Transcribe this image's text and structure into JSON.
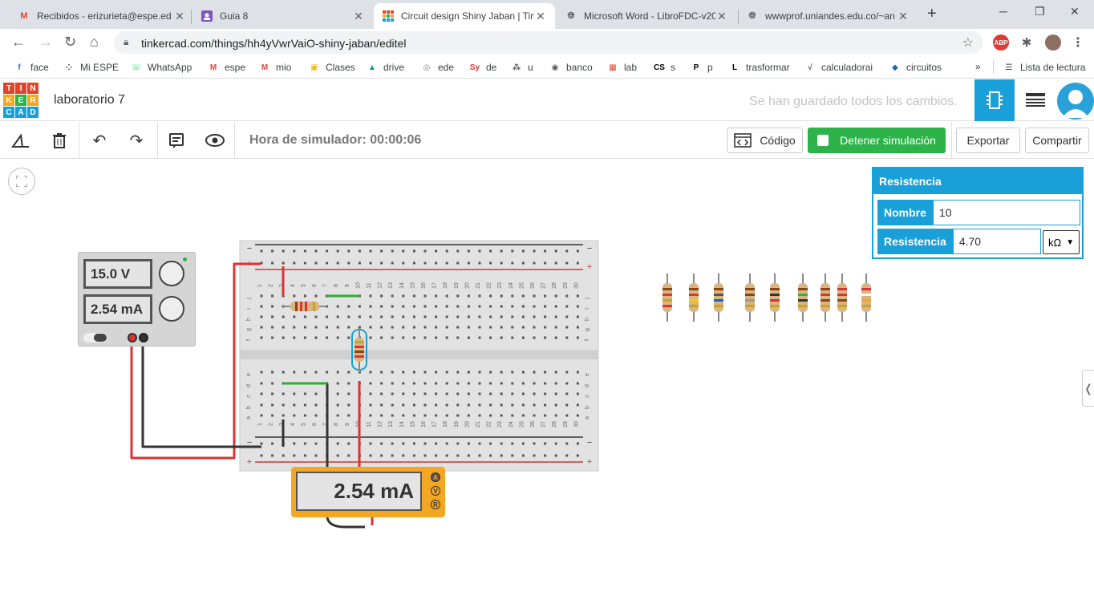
{
  "browser": {
    "tabs": [
      {
        "title": "Recibidos - erizurieta@espe.ed",
        "icon": "gmail-icon",
        "active": false
      },
      {
        "title": "Guia 8",
        "icon": "classroom-icon",
        "active": false
      },
      {
        "title": "Circuit design Shiny Jaban | Tin",
        "icon": "tinkercad-icon",
        "active": true
      },
      {
        "title": "Microsoft Word - LibroFDC-v20",
        "icon": "globe-icon",
        "active": false
      },
      {
        "title": "wwwprof.uniandes.edu.co/~an",
        "icon": "globe-icon",
        "active": false
      }
    ],
    "url": "tinkercad.com/things/hh4yVwrVaiO-shiny-jaban/editel",
    "bookmarks": [
      {
        "label": "face",
        "icon": "facebook-icon",
        "color": "#1877f2"
      },
      {
        "label": "Mi ESPE",
        "icon": "grid-icon",
        "color": "#333333"
      },
      {
        "label": "WhatsApp",
        "icon": "whatsapp-icon",
        "color": "#25d366"
      },
      {
        "label": "espe",
        "icon": "gmail-icon",
        "color": "#ea4335"
      },
      {
        "label": "mio",
        "icon": "gmail-icon",
        "color": "#ea4335"
      },
      {
        "label": "Clases",
        "icon": "classroom-icon",
        "color": "#f4b400"
      },
      {
        "label": "drive",
        "icon": "drive-icon",
        "color": "#0f9d58"
      },
      {
        "label": "ede",
        "icon": "ede-icon",
        "color": "#888888"
      },
      {
        "label": "de",
        "icon": "sy-icon",
        "color": "#e53935"
      },
      {
        "label": "u",
        "icon": "u-icon",
        "color": "#555555"
      },
      {
        "label": "banco",
        "icon": "globe-icon",
        "color": "#555555"
      },
      {
        "label": "lab",
        "icon": "tinkercad-icon",
        "color": "#e0452b"
      },
      {
        "label": "s",
        "icon": "cs-icon",
        "color": "#000000"
      },
      {
        "label": "p",
        "icon": "p-icon",
        "color": "#000000"
      },
      {
        "label": "trasformar",
        "icon": "l-icon",
        "color": "#000000"
      },
      {
        "label": "calculadorai",
        "icon": "calc-icon",
        "color": "#555555"
      },
      {
        "label": "circuitos",
        "icon": "circuit-icon",
        "color": "#1565c0"
      }
    ],
    "reading_list": "Lista de lectura"
  },
  "header": {
    "project_name": "laboratorio 7",
    "save_status": "Se han guardado todos los cambios."
  },
  "toolbar": {
    "sim_time": "Hora de simulador: 00:00:06",
    "code_label": "Código",
    "stop_label": "Detener simulación",
    "export_label": "Exportar",
    "share_label": "Compartir"
  },
  "inspector": {
    "title": "Resistencia",
    "name_label": "Nombre",
    "name_value": "10",
    "resistance_label": "Resistencia",
    "resistance_value": "4.70",
    "unit": "kΩ"
  },
  "power_supply": {
    "voltage": "15.0 V",
    "current": "2.54 mA"
  },
  "multimeter": {
    "reading": "2.54 mA",
    "modes": [
      "A",
      "V",
      "R"
    ]
  },
  "breadboard": {
    "columns": [
      "1",
      "2",
      "3",
      "4",
      "5",
      "6",
      "7",
      "8",
      "9",
      "10",
      "11",
      "12",
      "13",
      "14",
      "15",
      "16",
      "17",
      "18",
      "19",
      "20",
      "21",
      "22",
      "23",
      "24",
      "25",
      "26",
      "27",
      "28",
      "29",
      "30"
    ],
    "top_rows": [
      "j",
      "i",
      "h",
      "g",
      "f"
    ],
    "bottom_rows": [
      "e",
      "d",
      "c",
      "b",
      "a"
    ]
  },
  "colors": {
    "accent": "#1aa0d8",
    "stop_green": "#2db34a",
    "meter_orange": "#f5a623"
  }
}
